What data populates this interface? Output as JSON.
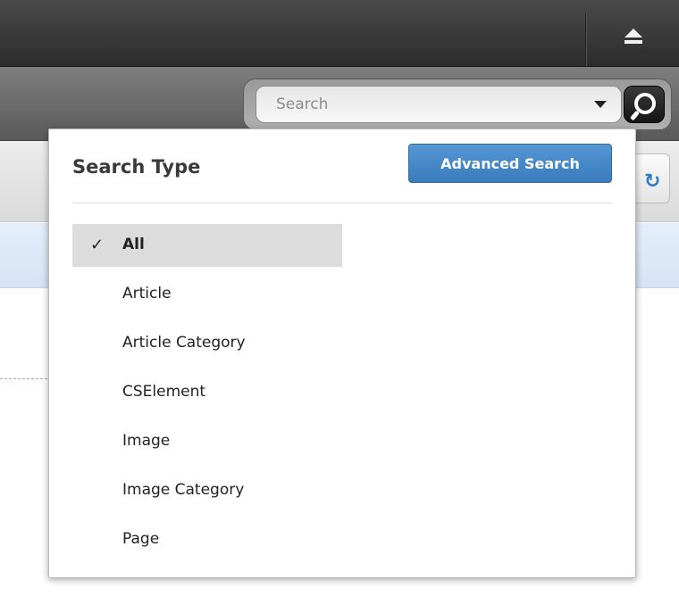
{
  "search": {
    "placeholder": "Search"
  },
  "popover": {
    "title": "Search Type",
    "advanced_button": "Advanced Search",
    "selected_index": 0,
    "items": [
      {
        "label": "All",
        "selected": true
      },
      {
        "label": "Article",
        "selected": false
      },
      {
        "label": "Article Category",
        "selected": false
      },
      {
        "label": "CSElement",
        "selected": false
      },
      {
        "label": "Image",
        "selected": false
      },
      {
        "label": "Image Category",
        "selected": false
      },
      {
        "label": "Page",
        "selected": false
      }
    ],
    "check_glyph": "✓"
  },
  "icons": {
    "eject": "eject-icon",
    "search": "magnifier-icon",
    "caret": "chevron-down-icon",
    "refresh": "refresh-icon"
  },
  "colors": {
    "accent": "#4a8acb",
    "topbar": "#3a3a3a",
    "selected_row": "#dcdcdc"
  }
}
